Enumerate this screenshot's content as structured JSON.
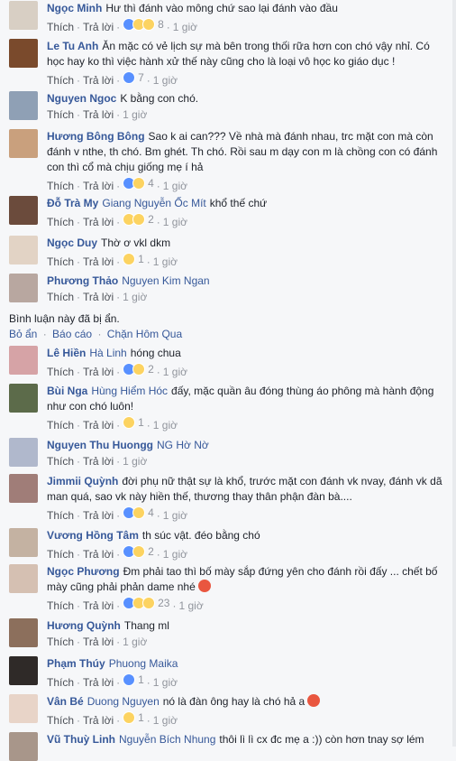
{
  "actions": {
    "like": "Thích",
    "reply": "Trả lời",
    "sep": "·"
  },
  "comments": [
    {
      "author": "Ngọc Minh",
      "tag": "",
      "text": "Hư thì đánh vào mông chứ sao lại đánh vào đầu",
      "reactions": [
        "like",
        "haha",
        "wow"
      ],
      "count": "8",
      "time": "1 giờ"
    },
    {
      "author": "Le Tu Anh",
      "tag": "",
      "text": "Ăn mặc có vẻ lịch sự mà bên trong thối rữa hơn con chó vậy nhỉ. Có học hay ko thì việc hành xử thế này cũng cho là loại vô học ko giáo dục !",
      "reactions": [
        "like"
      ],
      "count": "7",
      "time": "1 giờ"
    },
    {
      "author": "Nguyen Ngoc",
      "tag": "",
      "text": "K bằng con chó.",
      "reactions": [],
      "count": "",
      "time": "1 giờ"
    },
    {
      "author": "Hương Bông Bông",
      "tag": "",
      "text": "Sao k ai can??? Về nhà mà đánh nhau, trc mặt con mà còn đánh v nthe, th chó. Bm ghét. Th chó. Rồi sau m dạy con m là chồng con có đánh con thì cổ mà chịu giống mẹ í hả",
      "reactions": [
        "like",
        "haha"
      ],
      "count": "4",
      "time": "1 giờ"
    },
    {
      "author": "Đỗ Trà My",
      "tag": "Giang Nguyễn Ốc Mít",
      "text": "khổ thế chứ",
      "reactions": [
        "haha",
        "sad"
      ],
      "count": "2",
      "time": "1 giờ"
    },
    {
      "author": "Ngọc Duy",
      "tag": "",
      "text": "Thờ ơ vkl dkm",
      "reactions": [
        "haha"
      ],
      "count": "1",
      "time": "1 giờ"
    },
    {
      "author": "Phương Thảo",
      "tag": "Nguyen Kim Ngan",
      "text": "",
      "reactions": [],
      "count": "",
      "time": "1 giờ"
    },
    {
      "author": "Lê Hiền",
      "tag": "Hà Linh",
      "text": "hóng chua",
      "reactions": [
        "like",
        "haha"
      ],
      "count": "2",
      "time": "1 giờ"
    },
    {
      "author": "Bùi Nga",
      "tag": "Hùng Hiểm Hóc",
      "text": "đấy, mặc quần âu đóng thùng áo phông mà hành động như con chó luôn!",
      "reactions": [
        "haha"
      ],
      "count": "1",
      "time": "1 giờ"
    },
    {
      "author": "Nguyen Thu Huongg",
      "tag": "NG Hờ Nờ",
      "text": "",
      "reactions": [],
      "count": "",
      "time": "1 giờ"
    },
    {
      "author": "Jimmii Quỳnh",
      "tag": "",
      "text": "đời phụ nữ thật sự là khổ, trước mặt con đánh vk nvay, đánh vk dã man quá, sao vk này hiền thế, thương thay thân phận đàn bà....",
      "reactions": [
        "like",
        "haha"
      ],
      "count": "4",
      "time": "1 giờ"
    },
    {
      "author": "Vương Hồng Tâm",
      "tag": "",
      "text": "th súc vật. đéo bằng chó",
      "reactions": [
        "like",
        "haha"
      ],
      "count": "2",
      "time": "1 giờ"
    },
    {
      "author": "Ngọc Phương",
      "tag": "",
      "text": "Đm phải tao thì bố mày sắp đứng yên cho đánh rồi đấy ... chết bố mày cũng phải phản dame nhé",
      "emoji": "angry",
      "reactions": [
        "like",
        "haha",
        "wow"
      ],
      "count": "23",
      "time": "1 giờ"
    },
    {
      "author": "Hương Quỳnh",
      "tag": "",
      "text": "Thang ml",
      "reactions": [],
      "count": "",
      "time": "1 giờ"
    },
    {
      "author": "Phạm Thúy",
      "tag": "Phuong Maika",
      "text": "",
      "reactions": [
        "like"
      ],
      "count": "1",
      "time": "1 giờ"
    },
    {
      "author": "Vân Bé",
      "tag": "Duong Nguyen",
      "text": "nó là đàn ông hay là chó hả a",
      "emoji": "angry",
      "reactions": [
        "haha"
      ],
      "count": "1",
      "time": "1 giờ"
    },
    {
      "author": "Vũ Thuỳ Linh",
      "tag": "Nguyễn Bích Nhung",
      "text": "thôi lì lì cx đc mẹ a :)) còn hơn tnay sợ lém",
      "reactions": [],
      "count": "",
      "time": ""
    }
  ],
  "hidden": {
    "note": "Bình luận này đã bị ẩn.",
    "unhide": "Bỏ ẩn",
    "report": "Báo cáo",
    "block": "Chặn Hôm Qua"
  },
  "colors": {
    "link": "#365899",
    "meta": "#90949c",
    "like": "#5890ff",
    "haha": "#fcd361",
    "angry": "#e9563f"
  },
  "avatars": [
    "avatar-1",
    "avatar-2",
    "avatar-3",
    "avatar-4",
    "avatar-5",
    "avatar-6",
    "avatar-7",
    "avatar-8",
    "avatar-9",
    "avatar-10",
    "avatar-11",
    "avatar-12",
    "avatar-13",
    "avatar-14",
    "avatar-15",
    "avatar-16",
    "avatar-17"
  ]
}
